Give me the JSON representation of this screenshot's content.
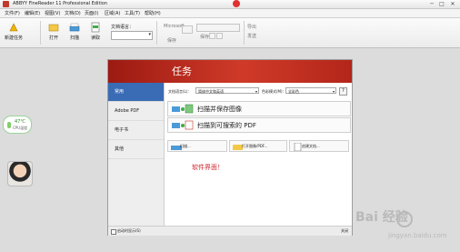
{
  "window": {
    "title": "ABBYY FineReader 11 Professional Edition",
    "controls": [
      "─",
      "□",
      "✕"
    ]
  },
  "menu": [
    "文件(F)",
    "编辑(E)",
    "视图(V)",
    "文档(D)",
    "页面(I)",
    "区域(A)",
    "工具(T)",
    "帮助(H)"
  ],
  "toolbar": {
    "new_task": "新建任务",
    "open": "打开",
    "scan": "扫描",
    "read": "读取",
    "doc_language_label": "文档语言：",
    "doc_language_value": "",
    "page_label": "保存",
    "small_a": "Microsoft",
    "small_b": "保存",
    "right_a": "导出",
    "right_b": "发送"
  },
  "side_widgets": {
    "weather_temp": "47℃",
    "weather_sub": "CPU温度"
  },
  "dialog": {
    "title": "任务",
    "sidebar": [
      "常用",
      "Adobe PDF",
      "电子书",
      "其他"
    ],
    "active_index": 0,
    "doc_language_label": "文档语言(L)：",
    "doc_language_value": "简体中文和英语",
    "color_mode_label": "色彩模式(M)：",
    "color_mode_value": "全彩色",
    "help": "?",
    "tasks": [
      "扫描并保存图像",
      "扫描到可搜索的 PDF"
    ],
    "sub_buttons": [
      "扫描...",
      "打开图像/PDF...",
      "创建文档..."
    ],
    "note": "软件界面！",
    "footer_checkbox": "启动时显示(S)",
    "footer_close": "关闭"
  },
  "watermark": {
    "brand": "Bai  经验",
    "url": "jingyan.baidu.com"
  },
  "colors": {
    "header_red": "#cf3a28",
    "active_blue": "#3a6bb5",
    "note_red": "#d0282f"
  }
}
